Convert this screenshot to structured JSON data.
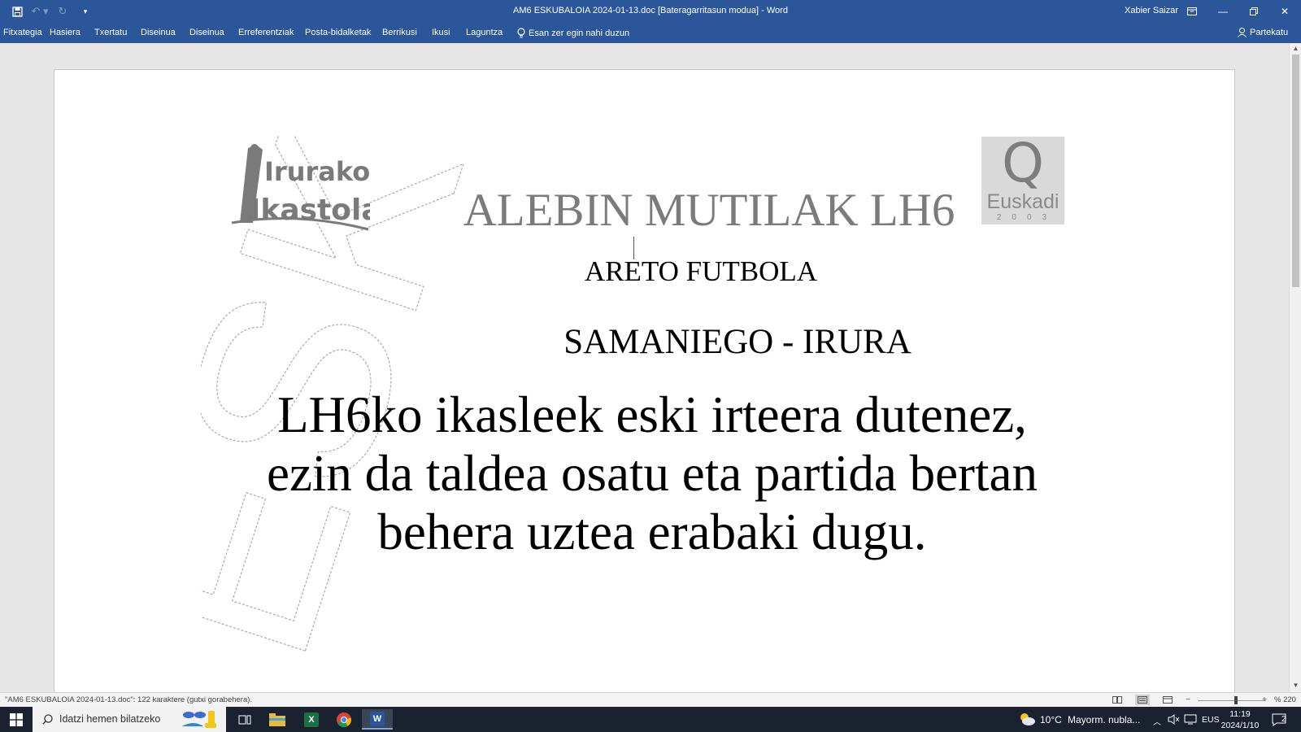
{
  "window": {
    "title": "AM6 ESKUBALOIA 2024-01-13.doc [Bateragarritasun modua]  -  Word",
    "user": "Xabier Saizar"
  },
  "ribbon": {
    "tabs": [
      "Fitxategia",
      "Hasiera",
      "Txertatu",
      "Diseinua",
      "Diseinua",
      "Erreferentziak",
      "Posta-bidalketak",
      "Berrikusi",
      "Ikusi",
      "Laguntza"
    ],
    "tell_me": "Esan zer egin nahi duzun",
    "share": "Partekatu"
  },
  "document": {
    "title": "ALEBIN MUTILAK LH6",
    "subtitle": "ARETO FUTBOLA",
    "match": "SAMANIEGO - IRURA",
    "body_lines": [
      "LH6ko ikasleek eski irteera dutenez,",
      "ezin da taldea osatu eta partida bertan",
      "behera uztea erabaki dugu."
    ],
    "logo_left": {
      "line1": "Irurako",
      "line2": "Ikastola"
    },
    "logo_right": {
      "letter": "Q",
      "word": "Euskadi",
      "year": "2003"
    },
    "watermark": "ESKOLA KIROLA"
  },
  "statusbar": {
    "message": "\"AM6 ESKUBALOIA 2024-01-13.doc\": 122 karaktere (gutxi gorabehera).",
    "zoom": "% 220"
  },
  "taskbar": {
    "search_placeholder": "Idatzi hemen bilatzeko",
    "weather_temp": "10°C",
    "weather_desc": "Mayorm. nubla...",
    "language": "EUS",
    "time": "11:19",
    "date": "2024/1/10",
    "notifications": "2"
  },
  "colors": {
    "word_blue": "#2b579a",
    "taskbar": "#1a2230"
  }
}
